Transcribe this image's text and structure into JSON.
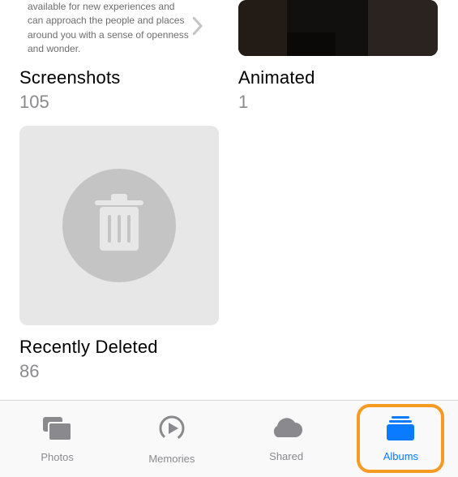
{
  "albums": [
    {
      "id": "screenshots",
      "title": "Screenshots",
      "count": "105",
      "cover_text": "available for new experiences and can approach the people and places around you with a sense of openness and wonder."
    },
    {
      "id": "animated",
      "title": "Animated",
      "count": "1"
    },
    {
      "id": "recently-deleted",
      "title": "Recently Deleted",
      "count": "86"
    }
  ],
  "tabs": {
    "photos": "Photos",
    "memories": "Memories",
    "shared": "Shared",
    "albums": "Albums"
  }
}
